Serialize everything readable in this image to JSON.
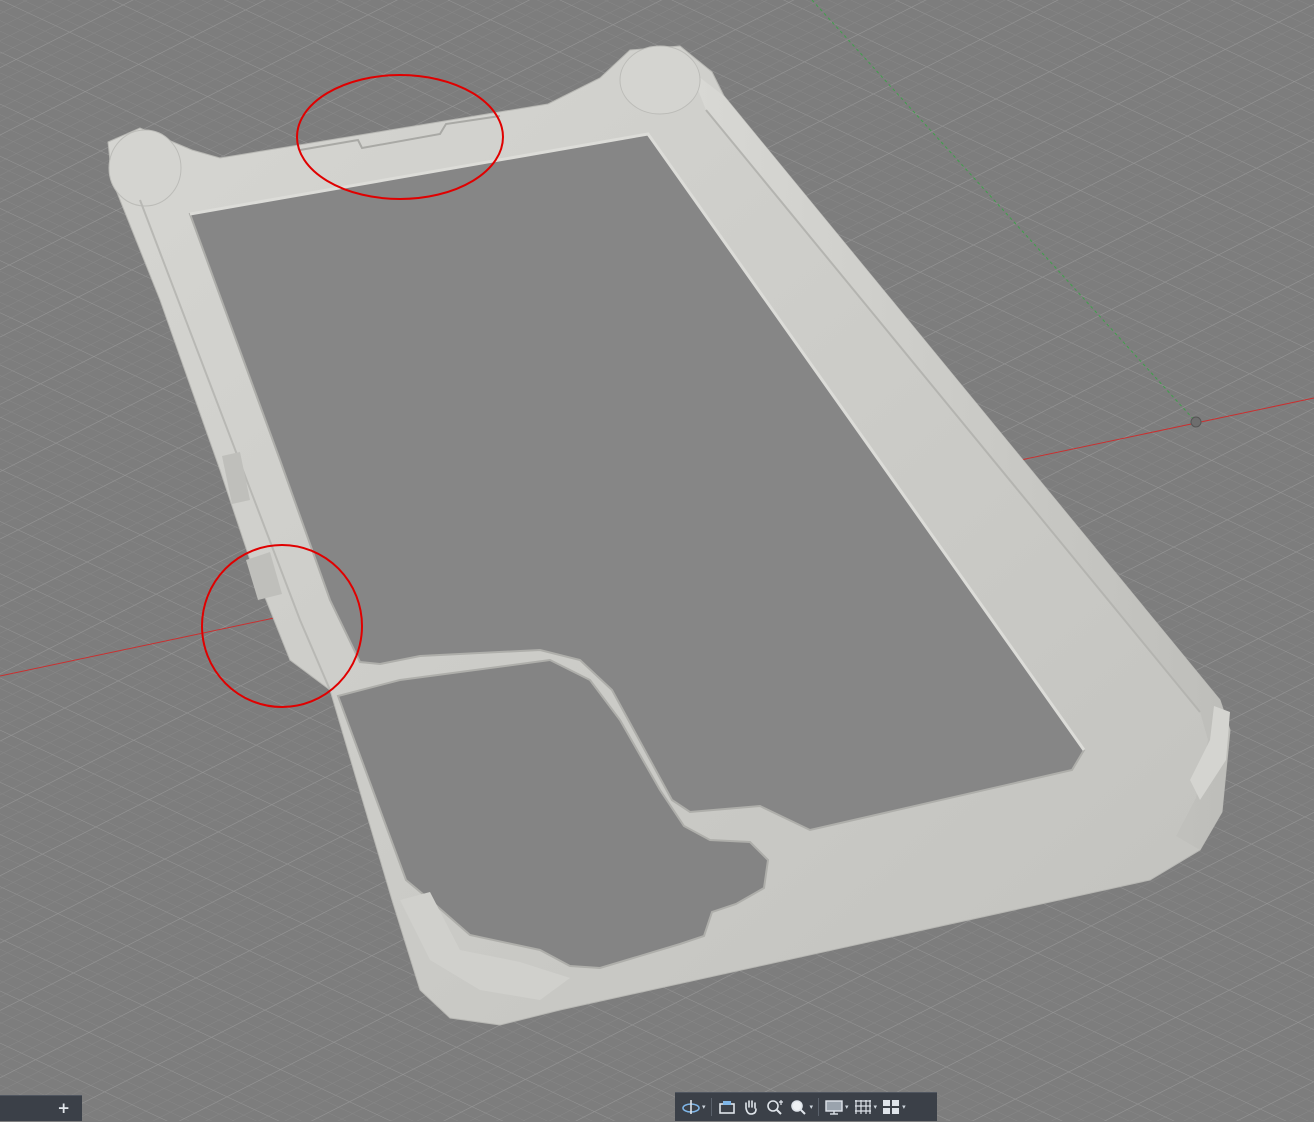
{
  "viewport": {
    "background": "#7d7d7d",
    "grid_minor": "#878787",
    "grid_major": "#959595",
    "axis_x_color": "#c93030",
    "axis_y_color": "#3fa04a",
    "model_color": "#c9c9c5",
    "markup_color": "#e00000",
    "markup_count": 2
  },
  "browser_tab": {
    "add_label": "+"
  },
  "toolbar": {
    "items": [
      {
        "name": "orbit-icon",
        "has_menu": true
      },
      {
        "name": "look-at-icon",
        "has_menu": false
      },
      {
        "name": "pan-icon",
        "has_menu": false
      },
      {
        "name": "zoom-icon",
        "has_menu": false
      },
      {
        "name": "zoom-window-icon",
        "has_menu": true
      },
      {
        "name": "display-settings-icon",
        "has_menu": true
      },
      {
        "name": "grid-icon",
        "has_menu": true
      },
      {
        "name": "viewports-icon",
        "has_menu": true
      }
    ],
    "caret": "▾"
  }
}
